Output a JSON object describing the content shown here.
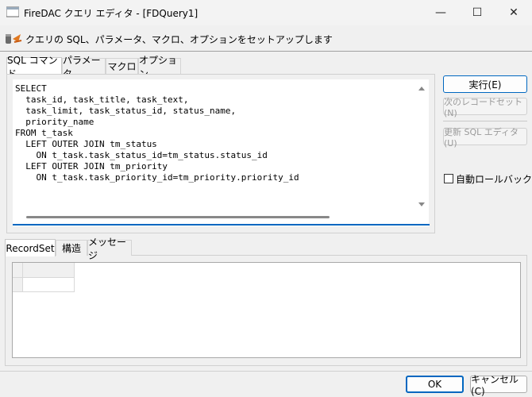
{
  "window": {
    "title": "FireDAC クエリ エディタ - [FDQuery1]",
    "minimize_glyph": "—",
    "maximize_glyph": "☐",
    "close_glyph": "✕"
  },
  "header": {
    "text": "クエリの SQL、パラメータ、マクロ、オプションをセットアップします"
  },
  "query_tabs": [
    {
      "label": "SQL コマンド",
      "active": true
    },
    {
      "label": "パラメータ",
      "active": false
    },
    {
      "label": "マクロ",
      "active": false
    },
    {
      "label": "オプション",
      "active": false
    }
  ],
  "sql": {
    "text": "SELECT\n  task_id, task_title, task_text,\n  task_limit, task_status_id, status_name,\n  priority_name\nFROM t_task\n  LEFT OUTER JOIN tm_status\n    ON t_task.task_status_id=tm_status.status_id\n  LEFT OUTER JOIN tm_priority\n    ON t_task.task_priority_id=tm_priority.priority_id"
  },
  "side_buttons": {
    "execute": "実行(E)",
    "next_recordset": "次のレコードセット(N)",
    "sql_editor": "更新 SQL エディタ(U)",
    "auto_rollback": "自動ロールバック"
  },
  "result_tabs": [
    {
      "label": "RecordSet",
      "active": true
    },
    {
      "label": "構造",
      "active": false
    },
    {
      "label": "メッセージ",
      "active": false
    }
  ],
  "footer": {
    "ok": "OK",
    "cancel": "キャンセル(C)"
  },
  "colors": {
    "accent": "#0067c0",
    "window_bg": "#f0f0f0"
  }
}
